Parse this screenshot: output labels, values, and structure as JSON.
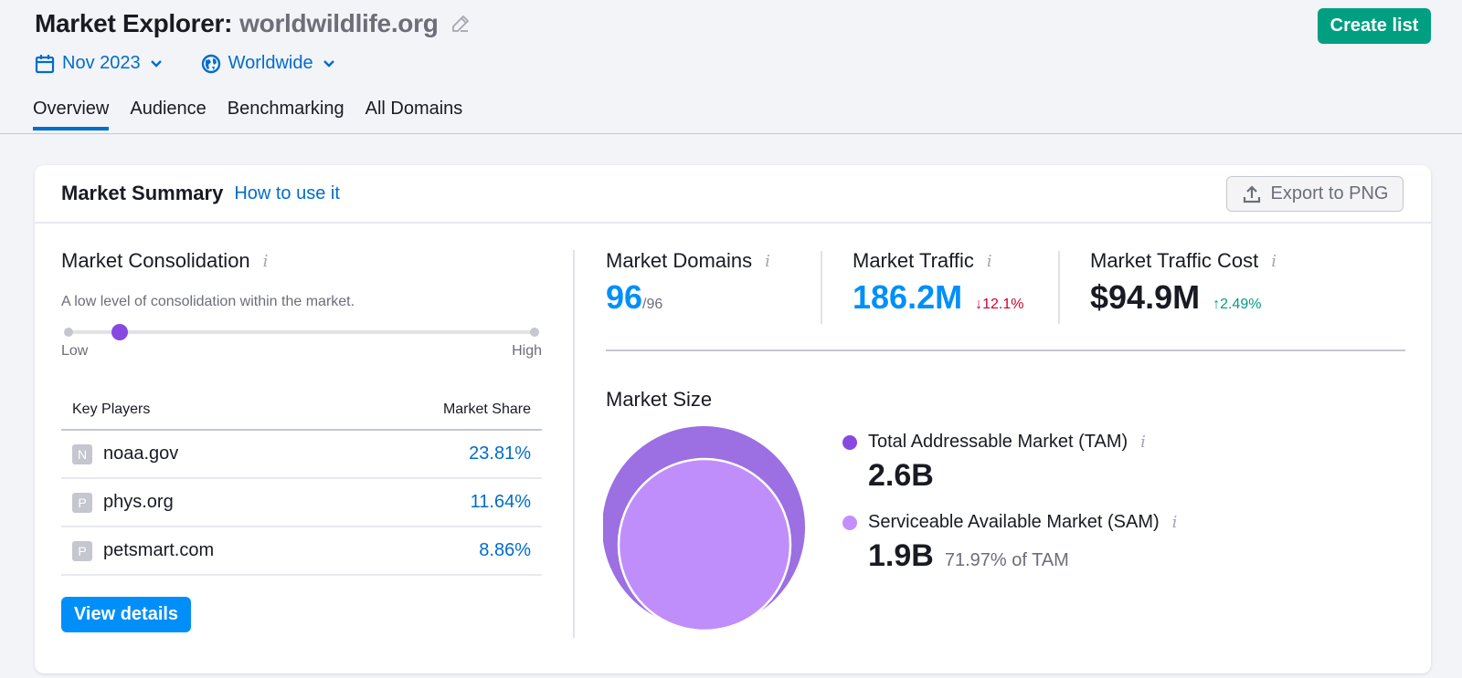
{
  "header": {
    "title_prefix": "Market Explorer:",
    "title_domain": "worldwildlife.org",
    "create_list_label": "Create list",
    "filters": {
      "date": "Nov 2023",
      "region": "Worldwide"
    },
    "tabs": [
      {
        "label": "Overview",
        "active": true
      },
      {
        "label": "Audience",
        "active": false
      },
      {
        "label": "Benchmarking",
        "active": false
      },
      {
        "label": "All Domains",
        "active": false
      }
    ]
  },
  "card": {
    "title": "Market Summary",
    "how_to_link": "How to use it",
    "export_label": "Export to PNG"
  },
  "consolidation": {
    "title": "Market Consolidation",
    "description": "A low level of consolidation within the market.",
    "level_fraction": 0.11,
    "low_label": "Low",
    "high_label": "High"
  },
  "key_players": {
    "col_player": "Key Players",
    "col_share": "Market Share",
    "rows": [
      {
        "favicon": "N",
        "domain": "noaa.gov",
        "share": "23.81%"
      },
      {
        "favicon": "P",
        "domain": "phys.org",
        "share": "11.64%"
      },
      {
        "favicon": "P",
        "domain": "petsmart.com",
        "share": "8.86%"
      }
    ],
    "view_details_label": "View details"
  },
  "metrics": {
    "domains": {
      "label": "Market Domains",
      "value": "96",
      "total": "/96"
    },
    "traffic": {
      "label": "Market Traffic",
      "value": "186.2M",
      "delta": "12.1%",
      "direction": "down"
    },
    "cost": {
      "label": "Market Traffic Cost",
      "value": "$94.9M",
      "delta": "2.49%",
      "direction": "up"
    }
  },
  "market_size": {
    "title": "Market Size",
    "tam": {
      "label": "Total Addressable Market (TAM)",
      "value": "2.6B",
      "color": "#8649e1"
    },
    "sam": {
      "label": "Serviceable Available Market (SAM)",
      "value": "1.9B",
      "pct_of_tam": "71.97% of TAM",
      "color": "#c38fff"
    }
  },
  "colors": {
    "accent_blue": "#006dca",
    "value_blue": "#008ff8",
    "create_green": "#009f81",
    "down_red": "#d1002f",
    "up_green": "#009f81",
    "tam_bubble": "#9c6fe3",
    "sam_bubble": "#c08efa"
  },
  "icons": {
    "edit": "pencil-icon",
    "calendar": "calendar-icon",
    "globe": "globe-icon",
    "chevron": "chevron-down-icon",
    "export": "upload-icon",
    "info": "info-icon",
    "arrow_down": "arrow-down-icon",
    "arrow_up": "arrow-up-icon"
  }
}
